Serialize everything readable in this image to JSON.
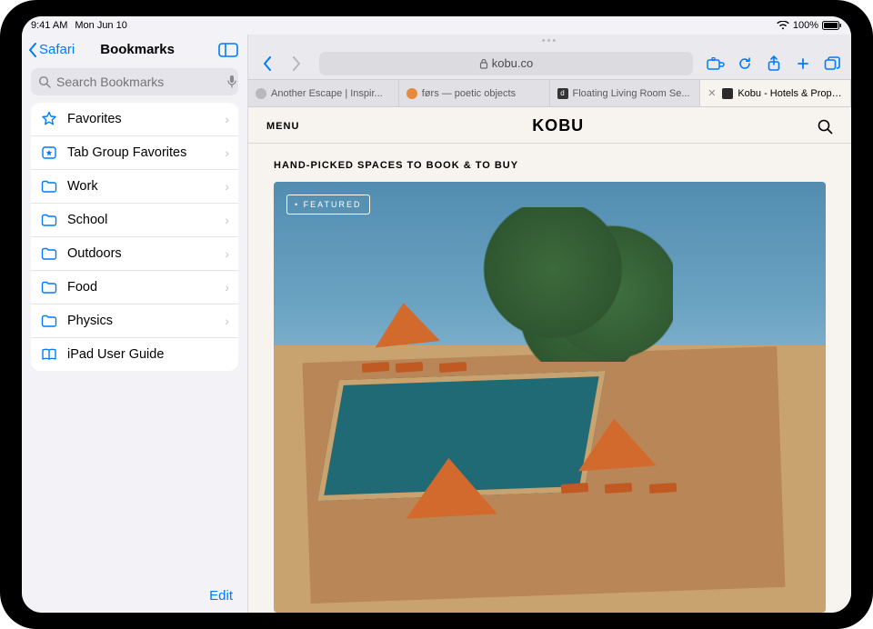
{
  "statusbar": {
    "time": "9:41 AM",
    "date": "Mon Jun 10",
    "battery": "100%"
  },
  "sidebar": {
    "back_label": "Safari",
    "title": "Bookmarks",
    "search_placeholder": "Search Bookmarks",
    "items": [
      {
        "icon": "star",
        "label": "Favorites",
        "chevron": true
      },
      {
        "icon": "tabstar",
        "label": "Tab Group Favorites",
        "chevron": true
      },
      {
        "icon": "folder",
        "label": "Work",
        "chevron": true
      },
      {
        "icon": "folder",
        "label": "School",
        "chevron": true
      },
      {
        "icon": "folder",
        "label": "Outdoors",
        "chevron": true
      },
      {
        "icon": "folder",
        "label": "Food",
        "chevron": true
      },
      {
        "icon": "folder",
        "label": "Physics",
        "chevron": true
      },
      {
        "icon": "book",
        "label": "iPad User Guide",
        "chevron": false
      }
    ],
    "edit_label": "Edit"
  },
  "toolbar": {
    "url_host": "kobu.co"
  },
  "tabs": [
    {
      "label": "Another Escape | Inspir...",
      "favicon": "#b9b9bd",
      "active": false
    },
    {
      "label": "førs — poetic objects",
      "favicon": "#e88a3b",
      "active": false
    },
    {
      "label": "Floating Living Room Se...",
      "favicon": "#333333",
      "active": false
    },
    {
      "label": "Kobu - Hotels & Propert...",
      "favicon": "#2a2a2a",
      "active": true
    }
  ],
  "page": {
    "menu_label": "MENU",
    "logo": "KOBU",
    "tagline": "HAND-PICKED SPACES TO BOOK & TO BUY",
    "featured_badge": "• FEATURED"
  }
}
